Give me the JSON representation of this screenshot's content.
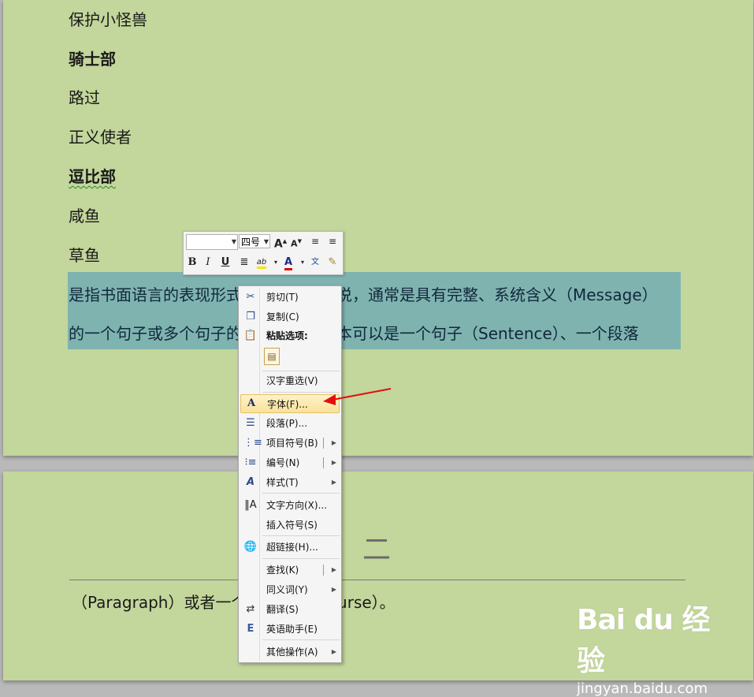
{
  "document": {
    "lines": [
      {
        "text": "保护小怪兽",
        "bold": false
      },
      {
        "text": "骑士部",
        "bold": true
      },
      {
        "text": "路过",
        "bold": false
      },
      {
        "text": "正义使者",
        "bold": false
      },
      {
        "text": "逗比部",
        "bold": true
      },
      {
        "text": "咸鱼",
        "bold": false
      },
      {
        "text": "草鱼",
        "bold": false
      }
    ],
    "selected_line_1": "是指书面语言的表现形式，从文本角度说，通常是具有完整、系统含义（Message）",
    "selected_line_2": "的一个句子或多个句子的组合。一个文本可以是一个句子（Sentence）、一个段落",
    "page2_number": "二",
    "page2_line": "（Paragraph）或者一个篇章（Discourse）。"
  },
  "mini_toolbar": {
    "font_size": "四号",
    "bold": "B",
    "italic": "I",
    "underline": "U",
    "grow_font": "A",
    "shrink_font": "A",
    "font_color_label": "A",
    "highlight_label": "ab",
    "phonetic": "文"
  },
  "context_menu": {
    "items": [
      {
        "label": "剪切(T)",
        "icon": "scissors-icon"
      },
      {
        "label": "复制(C)",
        "icon": "copy-icon"
      },
      {
        "label": "粘贴选项:",
        "icon": "paste-icon"
      },
      {
        "label": "汉字重选(V)",
        "icon": ""
      },
      {
        "label": "字体(F)...",
        "icon": "font-icon"
      },
      {
        "label": "段落(P)...",
        "icon": "paragraph-icon"
      },
      {
        "label": "项目符号(B)",
        "icon": "bullets-icon"
      },
      {
        "label": "编号(N)",
        "icon": "numbering-icon"
      },
      {
        "label": "样式(T)",
        "icon": "styles-icon"
      },
      {
        "label": "文字方向(X)...",
        "icon": "text-direction-icon"
      },
      {
        "label": "插入符号(S)",
        "icon": ""
      },
      {
        "label": "超链接(H)...",
        "icon": "hyperlink-icon"
      },
      {
        "label": "查找(K)",
        "icon": ""
      },
      {
        "label": "同义词(Y)",
        "icon": ""
      },
      {
        "label": "翻译(S)",
        "icon": "translate-icon"
      },
      {
        "label": "英语助手(E)",
        "icon": "english-assistant-icon"
      },
      {
        "label": "其他操作(A)",
        "icon": ""
      }
    ]
  },
  "watermark": {
    "logo": "Bai du 经验",
    "url": "jingyan.baidu.com"
  },
  "colors": {
    "page_background": "#c3d69b",
    "selection": "#7fb3b0",
    "annotation_arrow": "#e01010",
    "menu_highlight": "#fbe29a"
  }
}
